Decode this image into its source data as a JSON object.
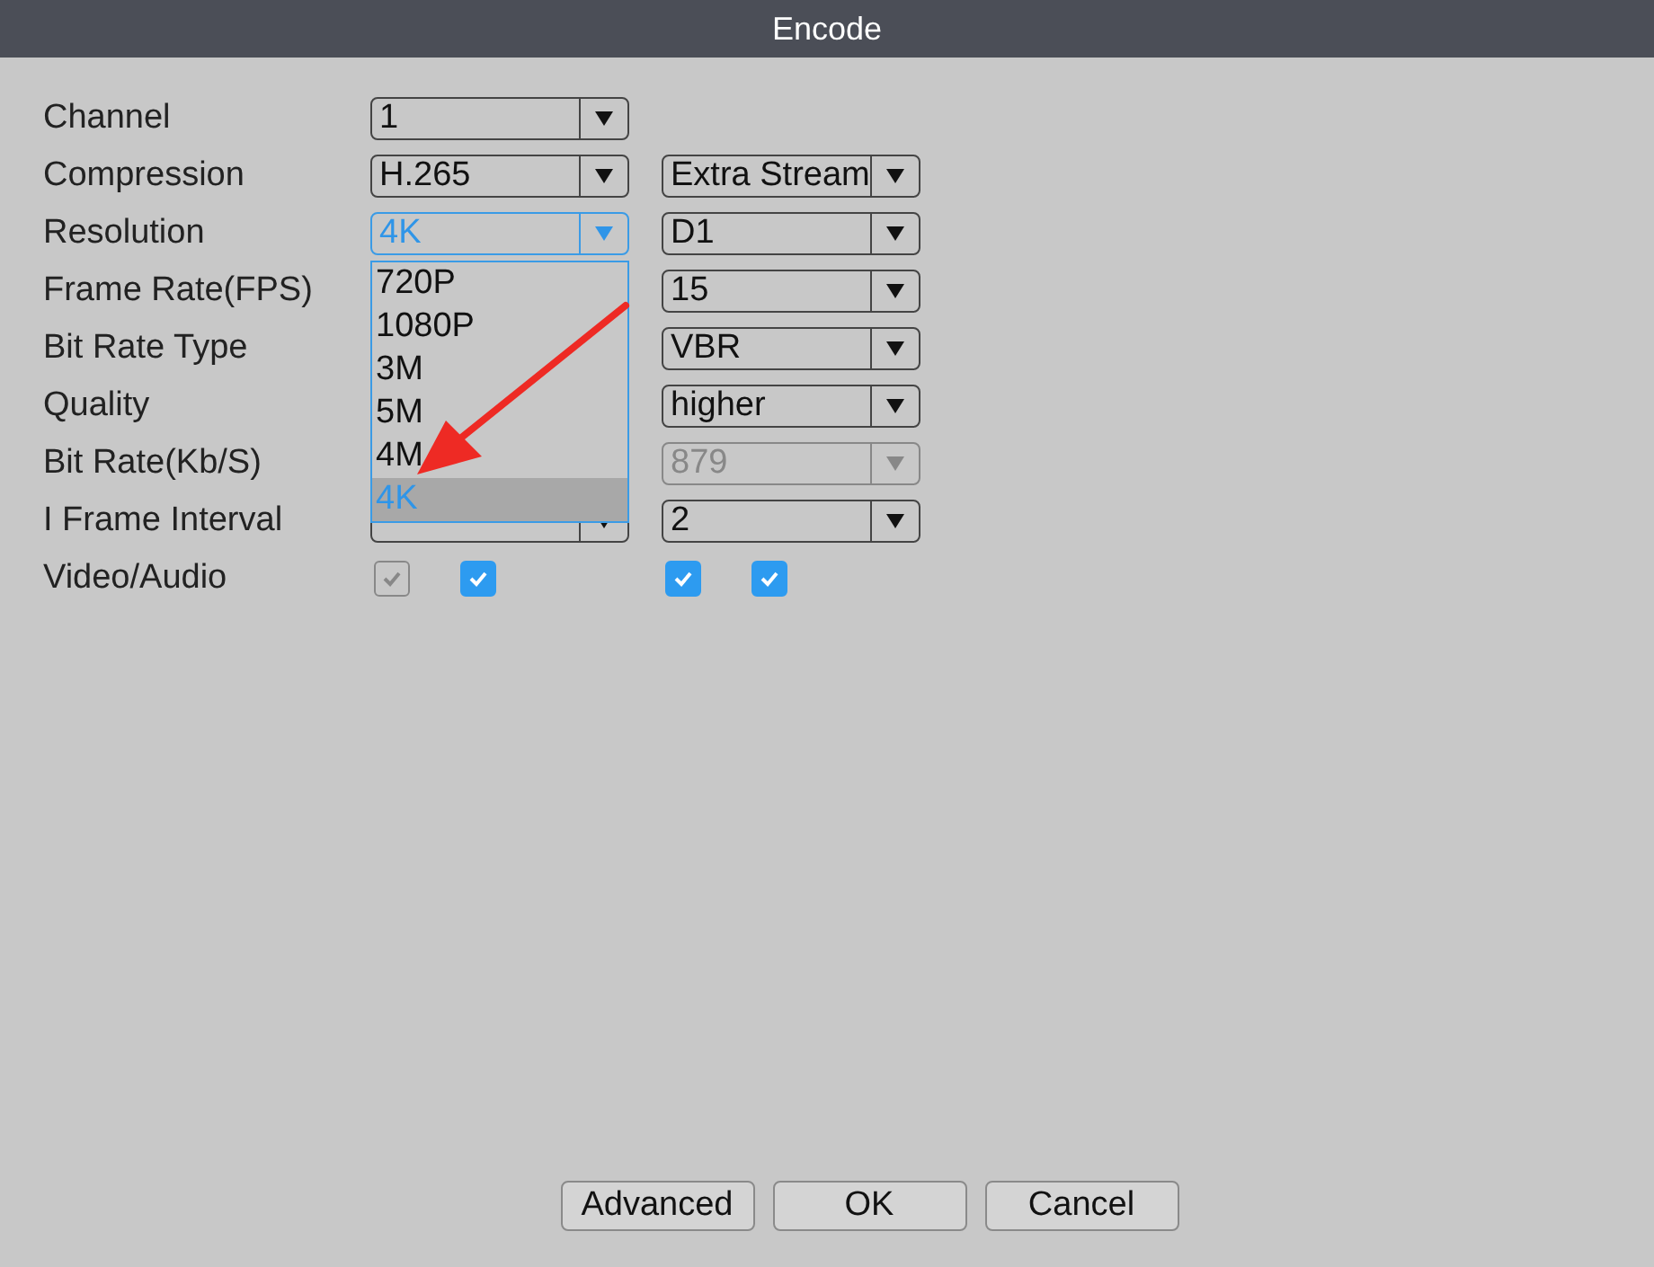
{
  "window": {
    "title": "Encode"
  },
  "rows": [
    {
      "kind": "select",
      "label": "Channel",
      "main": {
        "value": "1"
      }
    },
    {
      "kind": "select",
      "label": "Compression",
      "main": {
        "value": "H.265"
      },
      "extra": {
        "value": "Extra Stream"
      }
    },
    {
      "kind": "select",
      "label": "Resolution",
      "main": {
        "value": "4K",
        "open": true,
        "options": [
          {
            "label": "720P",
            "selected": false
          },
          {
            "label": "1080P",
            "selected": false
          },
          {
            "label": "3M",
            "selected": false
          },
          {
            "label": "5M",
            "selected": false
          },
          {
            "label": "4M",
            "selected": false
          },
          {
            "label": "4K",
            "selected": true
          }
        ]
      },
      "extra": {
        "value": "D1"
      }
    },
    {
      "kind": "select",
      "label": "Frame Rate(FPS)",
      "extra": {
        "value": "15"
      }
    },
    {
      "kind": "select",
      "label": "Bit Rate Type",
      "extra": {
        "value": "VBR"
      }
    },
    {
      "kind": "select",
      "label": "Quality",
      "extra": {
        "value": "higher"
      }
    },
    {
      "kind": "select",
      "label": "Bit Rate(Kb/S)",
      "extra": {
        "value": "879",
        "disabled": true
      }
    },
    {
      "kind": "select",
      "label": "I Frame Interval",
      "main": {
        "disabled": false
      },
      "extra": {
        "value": "2"
      }
    },
    {
      "kind": "checks",
      "label": "Video/Audio",
      "main": [
        {
          "checked": true,
          "disabled": true
        },
        {
          "checked": true,
          "disabled": false
        }
      ],
      "extra": [
        {
          "checked": true,
          "disabled": false
        },
        {
          "checked": true,
          "disabled": false
        }
      ]
    }
  ],
  "buttons": [
    "Advanced",
    "OK",
    "Cancel"
  ]
}
